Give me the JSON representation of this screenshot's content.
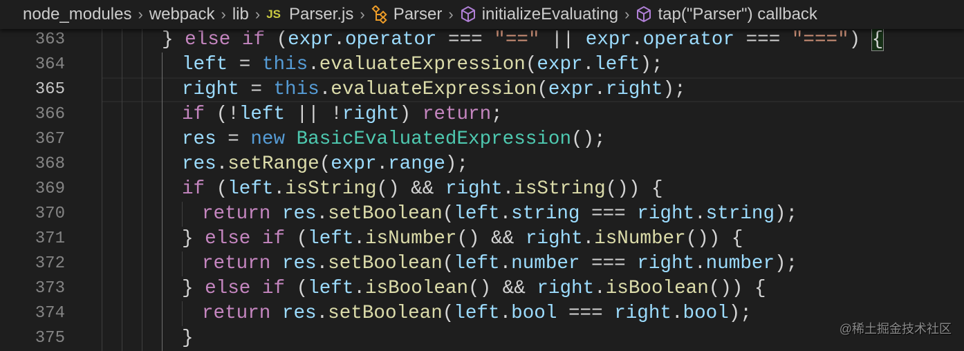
{
  "breadcrumb": {
    "items": [
      {
        "label": "node_modules",
        "icon": ""
      },
      {
        "label": "webpack",
        "icon": ""
      },
      {
        "label": "lib",
        "icon": ""
      },
      {
        "label": "Parser.js",
        "icon": "js-file-icon",
        "badge": "JS"
      },
      {
        "label": "Parser",
        "icon": "class-icon"
      },
      {
        "label": "initializeEvaluating",
        "icon": "method-cube-icon"
      },
      {
        "label": "tap(\"Parser\") callback",
        "icon": "method-cube-icon"
      }
    ]
  },
  "editor": {
    "current_line": 365,
    "lines": [
      {
        "n": "363",
        "indent": 3,
        "tokens": [
          [
            "p",
            "} "
          ],
          [
            "kw",
            "else if "
          ],
          [
            "p",
            "("
          ],
          [
            "v",
            "expr"
          ],
          [
            "p",
            "."
          ],
          [
            "v",
            "operator"
          ],
          [
            "p",
            " === "
          ],
          [
            "st",
            "\"==\""
          ],
          [
            "p",
            " || "
          ],
          [
            "v",
            "expr"
          ],
          [
            "p",
            "."
          ],
          [
            "v",
            "operator"
          ],
          [
            "p",
            " === "
          ],
          [
            "st",
            "\"===\""
          ],
          [
            "p",
            ") "
          ],
          [
            "match",
            "{"
          ]
        ]
      },
      {
        "n": "364",
        "indent": 4,
        "tokens": [
          [
            "v",
            "left"
          ],
          [
            "p",
            " = "
          ],
          [
            "th",
            "this"
          ],
          [
            "p",
            "."
          ],
          [
            "fn",
            "evaluateExpression"
          ],
          [
            "p",
            "("
          ],
          [
            "v",
            "expr"
          ],
          [
            "p",
            "."
          ],
          [
            "v",
            "left"
          ],
          [
            "p",
            ");"
          ]
        ]
      },
      {
        "n": "365",
        "indent": 4,
        "tokens": [
          [
            "v",
            "right"
          ],
          [
            "p",
            " = "
          ],
          [
            "th",
            "this"
          ],
          [
            "p",
            "."
          ],
          [
            "fn",
            "evaluateExpression"
          ],
          [
            "p",
            "("
          ],
          [
            "v",
            "expr"
          ],
          [
            "p",
            "."
          ],
          [
            "v",
            "right"
          ],
          [
            "p",
            ");"
          ]
        ]
      },
      {
        "n": "366",
        "indent": 4,
        "tokens": [
          [
            "kw",
            "if"
          ],
          [
            "p",
            " (!"
          ],
          [
            "v",
            "left"
          ],
          [
            "p",
            " || !"
          ],
          [
            "v",
            "right"
          ],
          [
            "p",
            ") "
          ],
          [
            "kw",
            "return"
          ],
          [
            "p",
            ";"
          ]
        ]
      },
      {
        "n": "367",
        "indent": 4,
        "tokens": [
          [
            "v",
            "res"
          ],
          [
            "p",
            " = "
          ],
          [
            "th",
            "new "
          ],
          [
            "cl",
            "BasicEvaluatedExpression"
          ],
          [
            "p",
            "();"
          ]
        ]
      },
      {
        "n": "368",
        "indent": 4,
        "tokens": [
          [
            "v",
            "res"
          ],
          [
            "p",
            "."
          ],
          [
            "fn",
            "setRange"
          ],
          [
            "p",
            "("
          ],
          [
            "v",
            "expr"
          ],
          [
            "p",
            "."
          ],
          [
            "v",
            "range"
          ],
          [
            "p",
            ");"
          ]
        ]
      },
      {
        "n": "369",
        "indent": 4,
        "tokens": [
          [
            "kw",
            "if"
          ],
          [
            "p",
            " ("
          ],
          [
            "v",
            "left"
          ],
          [
            "p",
            "."
          ],
          [
            "fn",
            "isString"
          ],
          [
            "p",
            "() && "
          ],
          [
            "v",
            "right"
          ],
          [
            "p",
            "."
          ],
          [
            "fn",
            "isString"
          ],
          [
            "p",
            "()) {"
          ]
        ]
      },
      {
        "n": "370",
        "indent": 5,
        "tokens": [
          [
            "kw",
            "return "
          ],
          [
            "v",
            "res"
          ],
          [
            "p",
            "."
          ],
          [
            "fn",
            "setBoolean"
          ],
          [
            "p",
            "("
          ],
          [
            "v",
            "left"
          ],
          [
            "p",
            "."
          ],
          [
            "v",
            "string"
          ],
          [
            "p",
            " === "
          ],
          [
            "v",
            "right"
          ],
          [
            "p",
            "."
          ],
          [
            "v",
            "string"
          ],
          [
            "p",
            ");"
          ]
        ]
      },
      {
        "n": "371",
        "indent": 4,
        "tokens": [
          [
            "p",
            "} "
          ],
          [
            "kw",
            "else if"
          ],
          [
            "p",
            " ("
          ],
          [
            "v",
            "left"
          ],
          [
            "p",
            "."
          ],
          [
            "fn",
            "isNumber"
          ],
          [
            "p",
            "() && "
          ],
          [
            "v",
            "right"
          ],
          [
            "p",
            "."
          ],
          [
            "fn",
            "isNumber"
          ],
          [
            "p",
            "()) {"
          ]
        ]
      },
      {
        "n": "372",
        "indent": 5,
        "tokens": [
          [
            "kw",
            "return "
          ],
          [
            "v",
            "res"
          ],
          [
            "p",
            "."
          ],
          [
            "fn",
            "setBoolean"
          ],
          [
            "p",
            "("
          ],
          [
            "v",
            "left"
          ],
          [
            "p",
            "."
          ],
          [
            "v",
            "number"
          ],
          [
            "p",
            " === "
          ],
          [
            "v",
            "right"
          ],
          [
            "p",
            "."
          ],
          [
            "v",
            "number"
          ],
          [
            "p",
            ");"
          ]
        ]
      },
      {
        "n": "373",
        "indent": 4,
        "tokens": [
          [
            "p",
            "} "
          ],
          [
            "kw",
            "else if"
          ],
          [
            "p",
            " ("
          ],
          [
            "v",
            "left"
          ],
          [
            "p",
            "."
          ],
          [
            "fn",
            "isBoolean"
          ],
          [
            "p",
            "() && "
          ],
          [
            "v",
            "right"
          ],
          [
            "p",
            "."
          ],
          [
            "fn",
            "isBoolean"
          ],
          [
            "p",
            "()) {"
          ]
        ]
      },
      {
        "n": "374",
        "indent": 5,
        "tokens": [
          [
            "kw",
            "return "
          ],
          [
            "v",
            "res"
          ],
          [
            "p",
            "."
          ],
          [
            "fn",
            "setBoolean"
          ],
          [
            "p",
            "("
          ],
          [
            "v",
            "left"
          ],
          [
            "p",
            "."
          ],
          [
            "v",
            "bool"
          ],
          [
            "p",
            " === "
          ],
          [
            "v",
            "right"
          ],
          [
            "p",
            "."
          ],
          [
            "v",
            "bool"
          ],
          [
            "p",
            ");"
          ]
        ]
      },
      {
        "n": "375",
        "indent": 4,
        "tokens": [
          [
            "p",
            "}"
          ]
        ]
      }
    ]
  },
  "watermark": "@稀土掘金技术社区"
}
